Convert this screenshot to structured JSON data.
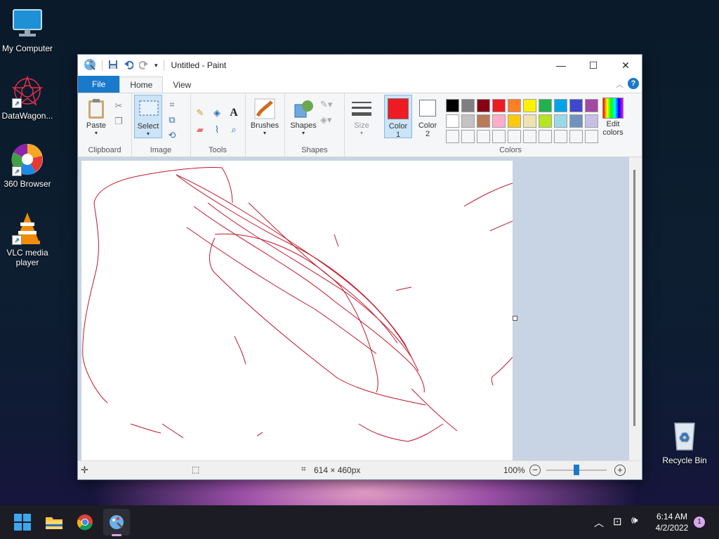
{
  "desktop": {
    "icons": [
      {
        "label": "My Computer"
      },
      {
        "label": "DataWagon..."
      },
      {
        "label": "360 Browser"
      },
      {
        "label": "VLC media player"
      },
      {
        "label": "Recycle Bin"
      }
    ]
  },
  "window": {
    "title": "Untitled - Paint",
    "controls": {
      "minimize": "—",
      "maximize": "☐",
      "close": "✕"
    }
  },
  "tabs": {
    "file": "File",
    "home": "Home",
    "view": "View"
  },
  "ribbon": {
    "groups": {
      "clipboard": "Clipboard",
      "image": "Image",
      "tools": "Tools",
      "shapes": "Shapes",
      "colors": "Colors"
    },
    "paste": "Paste",
    "select": "Select",
    "brushes": "Brushes",
    "shapes_btn": "Shapes",
    "size": "Size",
    "color1": "Color\n1",
    "color1_line1": "Color",
    "color1_line2": "1",
    "color2_line1": "Color",
    "color2_line2": "2",
    "edit_colors_line1": "Edit",
    "edit_colors_line2": "colors",
    "color1_value": "#ed1c24",
    "color2_value": "#ffffff",
    "palette_row1": [
      "#000000",
      "#7f7f7f",
      "#880015",
      "#ed1c24",
      "#ff7f27",
      "#fff200",
      "#22b14c",
      "#00a2e8",
      "#3f48cc",
      "#a349a4"
    ],
    "palette_row2": [
      "#ffffff",
      "#c3c3c3",
      "#b97a57",
      "#ffaec9",
      "#ffc90e",
      "#efe4b0",
      "#b5e61d",
      "#99d9ea",
      "#7092be",
      "#c8bfe7"
    ]
  },
  "status": {
    "canvas_size": "614 × 460px",
    "zoom": "100%",
    "zoom_fraction": 0.5
  },
  "taskbar": {
    "time": "6:14 AM",
    "date": "4/2/2022",
    "notification_count": "1"
  }
}
